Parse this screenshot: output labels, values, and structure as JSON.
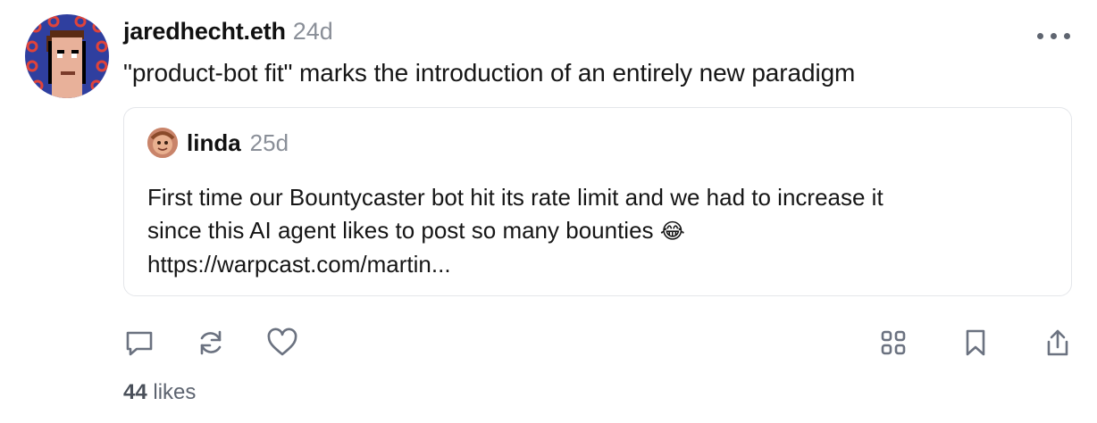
{
  "cast": {
    "author": "jaredhecht.eth",
    "time": "24d",
    "text": "\"product-bot fit\" marks the introduction of an entirely new paradigm",
    "likes_count": "44",
    "likes_label": "likes"
  },
  "quote": {
    "author": "linda",
    "time": "25d",
    "lines": [
      "First time our Bountycaster bot hit its rate limit and we had to increase it",
      "since this AI agent likes to post so many bounties",
      "https://warpcast.com/martin..."
    ],
    "emoji": "😂"
  },
  "icons": {
    "left": [
      "comment-icon",
      "recast-icon",
      "like-heart-icon"
    ],
    "right": [
      "grid-icon",
      "bookmark-icon",
      "share-icon"
    ],
    "more": "more-dots-icon"
  },
  "colors": {
    "text": "#161616",
    "muted": "#8a8f98",
    "icon": "#6b7280",
    "border": "#e4e6ea",
    "avatar_bg": "#2f3f9f",
    "avatar_dots": "#e0433a"
  }
}
